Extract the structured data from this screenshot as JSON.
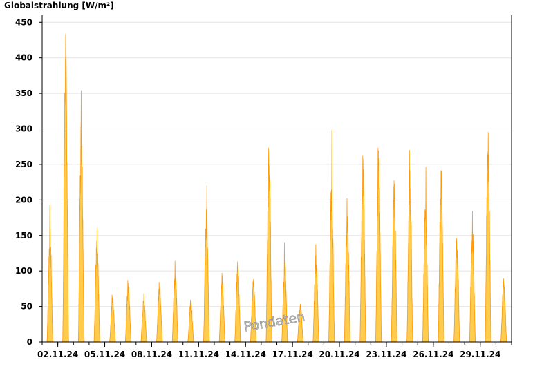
{
  "chart_data": {
    "type": "area",
    "title": "Globalstrahlung [W/m²]",
    "ylim": [
      0,
      460
    ],
    "yticks": [
      0,
      50,
      100,
      150,
      200,
      250,
      300,
      350,
      400,
      450
    ],
    "xlim_days": [
      1.0,
      31.0
    ],
    "xticks": [
      {
        "day": 2,
        "label": "02.11.24"
      },
      {
        "day": 5,
        "label": "05.11.24"
      },
      {
        "day": 8,
        "label": "08.11.24"
      },
      {
        "day": 11,
        "label": "11.11.24"
      },
      {
        "day": 14,
        "label": "14.11.24"
      },
      {
        "day": 17,
        "label": "17.11.24"
      },
      {
        "day": 20,
        "label": "20.11.24"
      },
      {
        "day": 23,
        "label": "23.11.24"
      },
      {
        "day": 26,
        "label": "26.11.24"
      },
      {
        "day": 29,
        "label": "29.11.24"
      }
    ],
    "grid": true,
    "fill_color": "#ffcc4d",
    "stroke_color": "#ff9900",
    "watermark": "Pondaten",
    "daily_peaks": [
      {
        "date": "01.11.24",
        "peak": 193,
        "secondary": 155
      },
      {
        "date": "02.11.24",
        "peak": 433,
        "secondary": 410
      },
      {
        "date": "03.11.24",
        "peak": 354,
        "secondary": 308
      },
      {
        "date": "04.11.24",
        "peak": 160,
        "secondary": 140
      },
      {
        "date": "05.11.24",
        "peak": 66,
        "secondary": 62
      },
      {
        "date": "06.11.24",
        "peak": 87,
        "secondary": 80
      },
      {
        "date": "07.11.24",
        "peak": 68,
        "secondary": 60
      },
      {
        "date": "08.11.24",
        "peak": 84,
        "secondary": 82
      },
      {
        "date": "09.11.24",
        "peak": 114,
        "secondary": 100
      },
      {
        "date": "10.11.24",
        "peak": 59,
        "secondary": 56
      },
      {
        "date": "11.11.24",
        "peak": 220,
        "secondary": 180
      },
      {
        "date": "12.11.24",
        "peak": 97,
        "secondary": 90
      },
      {
        "date": "13.11.24",
        "peak": 113,
        "secondary": 108
      },
      {
        "date": "14.11.24",
        "peak": 88,
        "secondary": 85
      },
      {
        "date": "15.11.24",
        "peak": 273,
        "secondary": 260
      },
      {
        "date": "16.11.24",
        "peak": 140,
        "secondary": 110
      },
      {
        "date": "17.11.24",
        "peak": 53,
        "secondary": 52
      },
      {
        "date": "18.11.24",
        "peak": 137,
        "secondary": 120
      },
      {
        "date": "19.11.24",
        "peak": 298,
        "secondary": 220
      },
      {
        "date": "20.11.24",
        "peak": 202,
        "secondary": 180
      },
      {
        "date": "21.11.24",
        "peak": 262,
        "secondary": 255
      },
      {
        "date": "22.11.24",
        "peak": 273,
        "secondary": 262
      },
      {
        "date": "23.11.24",
        "peak": 222,
        "secondary": 218
      },
      {
        "date": "24.11.24",
        "peak": 270,
        "secondary": 232
      },
      {
        "date": "25.11.24",
        "peak": 246,
        "secondary": 200
      },
      {
        "date": "26.11.24",
        "peak": 240,
        "secondary": 236
      },
      {
        "date": "27.11.24",
        "peak": 146,
        "secondary": 143
      },
      {
        "date": "28.11.24",
        "peak": 184,
        "secondary": 160
      },
      {
        "date": "29.11.24",
        "peak": 295,
        "secondary": 290
      },
      {
        "date": "30.11.24",
        "peak": 89,
        "secondary": 82
      }
    ]
  }
}
